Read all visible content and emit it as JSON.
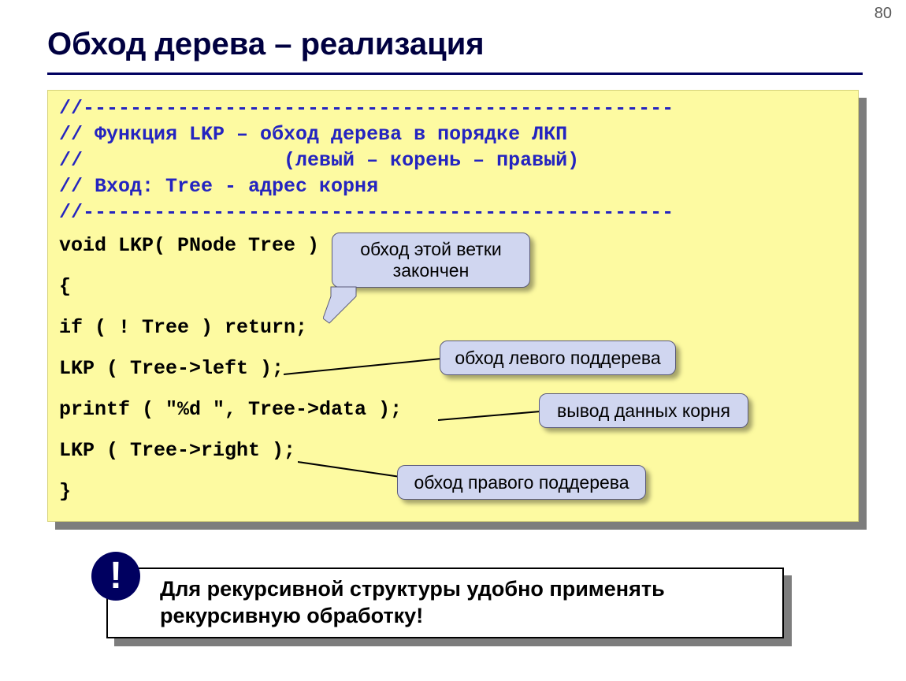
{
  "page_number": "80",
  "title": "Обход дерева – реализация",
  "code": {
    "comment1": "//--------------------------------------------------",
    "comment2": "// Функция LKP – обход дерева в порядке ЛКП",
    "comment3": "//                 (левый – корень – правый)",
    "comment4": "// Вход: Tree - адрес корня",
    "comment5": "//--------------------------------------------------",
    "line1": "void LKP( PNode Tree )",
    "line2": "{",
    "line3": "if ( ! Tree ) return;",
    "line4": "LKP ( Tree->left );",
    "line5": "printf ( \"%d \", Tree->data );",
    "line6": "LKP ( Tree->right );",
    "line7": "}"
  },
  "callouts": {
    "c1": "обход этой ветки закончен",
    "c2": "обход левого поддерева",
    "c3": "вывод данных корня",
    "c4": "обход правого поддерева"
  },
  "note": {
    "text": "Для рекурсивной структуры удобно применять рекурсивную обработку!",
    "bang": "!"
  }
}
